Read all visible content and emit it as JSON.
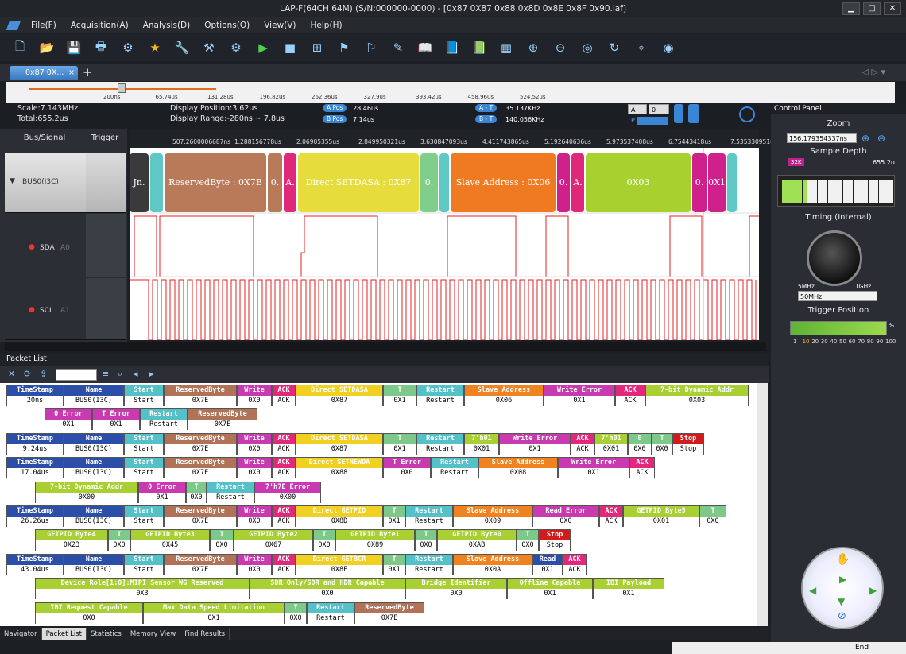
{
  "window": {
    "title": "LAP-F(64CH 64M) (S/N:000000-0000) - [0x87 0X87  0x88 0x8D 0x8E 0x8F 0x90.laf]"
  },
  "menu": [
    "File(F)",
    "Acquisition(A)",
    "Analysis(D)",
    "Options(O)",
    "View(V)",
    "Help(H)"
  ],
  "toolbar": [
    "new-file",
    "open-folder",
    "save",
    "print",
    "settings-save",
    "star",
    "wrench-gear",
    "tools",
    "gear",
    "run",
    "stop",
    "cursor-add",
    "cursor-flag",
    "cursor-marker",
    "brush",
    "book-open",
    "book-mark",
    "book-list",
    "binary",
    "zoom-in",
    "zoom-out",
    "zoom-fit",
    "refresh",
    "probe",
    "ring"
  ],
  "file_tab": {
    "label": "0x87 0X...",
    "close": "×",
    "add": "+"
  },
  "ruler": {
    "ticks": [
      "200ns",
      "65.74us",
      "131.28us",
      "196.82us",
      "262.36us",
      "327.9us",
      "393.42us",
      "458.96us",
      "524.52us"
    ]
  },
  "info": {
    "scale": "Scale:7.143MHz",
    "total": "Total:655.2us",
    "display_position": "Display Position:3.62us",
    "display_range": "Display Range:-280ns ~ 7.8us",
    "a_pos_label": "A Pos",
    "a_pos": "28.46us",
    "b_pos_label": "B Pos",
    "b_pos": "7.14us",
    "a_t_label": "A - T",
    "a_t": "35.137KHz",
    "b_t_label": "B - T",
    "b_t": "140.056KHz",
    "sel_a": "A",
    "sel_0": "0",
    "p_label": "P"
  },
  "signals": {
    "header_bus": "Bus/Signal",
    "header_trigger": "Trigger",
    "rows": [
      {
        "name": "BUS0(I3C)"
      },
      {
        "name": "SDA",
        "ch": "A0"
      },
      {
        "name": "SCL",
        "ch": "A1"
      }
    ]
  },
  "wave_ticks": [
    "507.2600006687ns",
    "1.288156778us",
    "2.06905355us",
    "2.849950321us",
    "3.630847093us",
    "4.411743865us",
    "5.192640636us",
    "5.973537408us",
    "6.75443418us",
    "7.535330951us"
  ],
  "segments": [
    {
      "label": "Jn.",
      "color": "#3a3a3a"
    },
    {
      "label": "",
      "color": "#5fc7c4"
    },
    {
      "label": "ReservedByte : 0X7E",
      "color": "#b97a5a"
    },
    {
      "label": "0.",
      "color": "#b97a5a"
    },
    {
      "label": "A.",
      "color": "#e0287a"
    },
    {
      "label": "Direct SETDASA : 0X87",
      "color": "#e6dc3b"
    },
    {
      "label": "0.",
      "color": "#7fcf8a"
    },
    {
      "label": "",
      "color": "#5fc7c4"
    },
    {
      "label": "Slave Address : 0X06",
      "color": "#f07a22"
    },
    {
      "label": "0.",
      "color": "#d0208c"
    },
    {
      "label": "A.",
      "color": "#e0287a"
    },
    {
      "label": "0X03",
      "color": "#a7d12e"
    },
    {
      "label": "0.",
      "color": "#d0208c"
    },
    {
      "label": "0X1",
      "color": "#d0208c"
    },
    {
      "label": "",
      "color": "#5fc7c4"
    }
  ],
  "control_panel": {
    "title": "Control Panel",
    "zoom_label": "Zoom",
    "zoom_value": "156.179354337ns",
    "depth_label": "Sample Depth",
    "depth_marker": "32K",
    "depth_value": "655.2u",
    "timing_label": "Timing (Internal)",
    "knob_min": "5MHz",
    "knob_max": "1GHz",
    "rate": "50MHz",
    "trigger_label": "Trigger Position",
    "trigger_pct": "%",
    "trigger_scale": [
      "1",
      "10",
      "20",
      "30",
      "40",
      "50",
      "60",
      "70",
      "80",
      "90",
      "100"
    ]
  },
  "packet_list": {
    "title": "Packet List",
    "rows": [
      [
        {
          "h": "TimeStamp",
          "v": "20ns",
          "c": "#2b4fa8",
          "w": 72
        },
        {
          "h": "Name",
          "v": "BUS0(I3C)",
          "c": "#2b4fa8",
          "w": 76
        },
        {
          "h": "Start",
          "v": "Start",
          "c": "#54c0c8",
          "w": 50
        },
        {
          "h": "ReservedByte",
          "v": "0X7E",
          "c": "#b07357",
          "w": 92
        },
        {
          "h": "Write",
          "v": "0X0",
          "c": "#c93ab0",
          "w": 44
        },
        {
          "h": "ACK",
          "v": "ACK",
          "c": "#e3287b",
          "w": 30
        },
        {
          "h": "Direct SETDASA",
          "v": "0X87",
          "c": "#f0d020",
          "w": 110
        },
        {
          "h": "T",
          "v": "0X1",
          "c": "#7cc98a",
          "w": 42
        },
        {
          "h": "Restart",
          "v": "Restart",
          "c": "#54c0c8",
          "w": 60
        },
        {
          "h": "Slave Address",
          "v": "0X06",
          "c": "#f0821f",
          "w": 100
        },
        {
          "h": "Write Error",
          "v": "0X1",
          "c": "#c93ab0",
          "w": 90
        },
        {
          "h": "ACK",
          "v": "ACK",
          "c": "#e3287b",
          "w": 38
        },
        {
          "h": "7-bit Dynamic Addr",
          "v": "0X03",
          "c": "#a8d032",
          "w": 130
        }
      ],
      [
        {
          "h": "0 Error",
          "v": "0X1",
          "c": "#c93ab0",
          "w": 60,
          "indent": 48
        },
        {
          "h": "T Error",
          "v": "0X1",
          "c": "#c93ab0",
          "w": 60
        },
        {
          "h": "Restart",
          "v": "Restart",
          "c": "#54c0c8",
          "w": 60
        },
        {
          "h": "ReservedByte",
          "v": "0X7E",
          "c": "#b07357",
          "w": 88
        }
      ],
      [
        {
          "h": "TimeStamp",
          "v": "9.24us",
          "c": "#2b4fa8",
          "w": 72
        },
        {
          "h": "Name",
          "v": "BUS0(I3C)",
          "c": "#2b4fa8",
          "w": 76
        },
        {
          "h": "Start",
          "v": "Start",
          "c": "#54c0c8",
          "w": 50
        },
        {
          "h": "ReservedByte",
          "v": "0X7E",
          "c": "#b07357",
          "w": 92
        },
        {
          "h": "Write",
          "v": "0X0",
          "c": "#c93ab0",
          "w": 44
        },
        {
          "h": "ACK",
          "v": "ACK",
          "c": "#e3287b",
          "w": 30
        },
        {
          "h": "Direct SETDASA",
          "v": "0X87",
          "c": "#f0d020",
          "w": 110
        },
        {
          "h": "T",
          "v": "0X1",
          "c": "#7cc98a",
          "w": 42
        },
        {
          "h": "Restart",
          "v": "Restart",
          "c": "#54c0c8",
          "w": 60
        },
        {
          "h": "7'h01",
          "v": "0X01",
          "c": "#a8d032",
          "w": 44
        },
        {
          "h": "Write Error",
          "v": "0X1",
          "c": "#c93ab0",
          "w": 90
        },
        {
          "h": "ACK",
          "v": "ACK",
          "c": "#e3287b",
          "w": 30
        },
        {
          "h": "7'h01",
          "v": "0X01",
          "c": "#a8d032",
          "w": 42
        },
        {
          "h": "0",
          "v": "0X0",
          "c": "#7cc98a",
          "w": 30
        },
        {
          "h": "T",
          "v": "0X0",
          "c": "#7cc98a",
          "w": 26
        },
        {
          "h": "Stop",
          "v": "Stop",
          "c": "#d01c1c",
          "w": 40
        }
      ],
      [
        {
          "h": "TimeStamp",
          "v": "17.04us",
          "c": "#2b4fa8",
          "w": 72
        },
        {
          "h": "Name",
          "v": "BUS0(I3C)",
          "c": "#2b4fa8",
          "w": 76
        },
        {
          "h": "Start",
          "v": "Start",
          "c": "#54c0c8",
          "w": 50
        },
        {
          "h": "ReservedByte",
          "v": "0X7E",
          "c": "#b07357",
          "w": 92
        },
        {
          "h": "Write",
          "v": "0X0",
          "c": "#c93ab0",
          "w": 44
        },
        {
          "h": "ACK",
          "v": "ACK",
          "c": "#e3287b",
          "w": 30
        },
        {
          "h": "Direct SETNEWDA",
          "v": "0X88",
          "c": "#f0d020",
          "w": 110
        },
        {
          "h": "T Error",
          "v": "0X0",
          "c": "#c93ab0",
          "w": 60
        },
        {
          "h": "Restart",
          "v": "Restart",
          "c": "#54c0c8",
          "w": 60
        },
        {
          "h": "Slave Address",
          "v": "0X08",
          "c": "#f0821f",
          "w": 100
        },
        {
          "h": "Write Error",
          "v": "0X1",
          "c": "#c93ab0",
          "w": 90
        },
        {
          "h": "ACK",
          "v": "ACK",
          "c": "#e3287b",
          "w": 32
        }
      ],
      [
        {
          "h": "7-bit Dynamic Addr",
          "v": "0X00",
          "c": "#a8d032",
          "w": 130,
          "indent": 36
        },
        {
          "h": "0 Error",
          "v": "0X1",
          "c": "#c93ab0",
          "w": 60
        },
        {
          "h": "T",
          "v": "0X0",
          "c": "#7cc98a",
          "w": 26
        },
        {
          "h": "Restart",
          "v": "Restart",
          "c": "#54c0c8",
          "w": 60
        },
        {
          "h": "7'h7E Error",
          "v": "0X00",
          "c": "#c93ab0",
          "w": 84
        }
      ],
      [
        {
          "h": "TimeStamp",
          "v": "26.26us",
          "c": "#2b4fa8",
          "w": 72
        },
        {
          "h": "Name",
          "v": "BUS0(I3C)",
          "c": "#2b4fa8",
          "w": 76
        },
        {
          "h": "Start",
          "v": "Start",
          "c": "#54c0c8",
          "w": 50
        },
        {
          "h": "ReservedByte",
          "v": "0X7E",
          "c": "#b07357",
          "w": 92
        },
        {
          "h": "Write",
          "v": "0X0",
          "c": "#c93ab0",
          "w": 44
        },
        {
          "h": "ACK",
          "v": "ACK",
          "c": "#e3287b",
          "w": 30
        },
        {
          "h": "Direct GETPID",
          "v": "0X8D",
          "c": "#f0d020",
          "w": 110
        },
        {
          "h": "T",
          "v": "0X1",
          "c": "#7cc98a",
          "w": 28
        },
        {
          "h": "Restart",
          "v": "Restart",
          "c": "#54c0c8",
          "w": 60
        },
        {
          "h": "Slave Address",
          "v": "0X09",
          "c": "#f0821f",
          "w": 100
        },
        {
          "h": "Read Error",
          "v": "0X0",
          "c": "#c93ab0",
          "w": 84
        },
        {
          "h": "ACK",
          "v": "ACK",
          "c": "#e3287b",
          "w": 30
        },
        {
          "h": "GETPID Byte5",
          "v": "0X01",
          "c": "#a8d032",
          "w": 96
        },
        {
          "h": "T",
          "v": "0X0",
          "c": "#7cc98a",
          "w": 34
        }
      ],
      [
        {
          "h": "GETPID Byte4",
          "v": "0X23",
          "c": "#a8d032",
          "w": 92,
          "indent": 36
        },
        {
          "h": "T",
          "v": "0X0",
          "c": "#7cc98a",
          "w": 28
        },
        {
          "h": "GETPID Byte3",
          "v": "0X45",
          "c": "#a8d032",
          "w": 100
        },
        {
          "h": "T",
          "v": "0X0",
          "c": "#7cc98a",
          "w": 30
        },
        {
          "h": "GETPID Byte2",
          "v": "0X67",
          "c": "#a8d032",
          "w": 100
        },
        {
          "h": "T",
          "v": "0X0",
          "c": "#7cc98a",
          "w": 28
        },
        {
          "h": "GETPID Byte1",
          "v": "0X89",
          "c": "#a8d032",
          "w": 100
        },
        {
          "h": "T",
          "v": "0X0",
          "c": "#7cc98a",
          "w": 28
        },
        {
          "h": "GETPID Byte0",
          "v": "0XAB",
          "c": "#a8d032",
          "w": 100
        },
        {
          "h": "T",
          "v": "0X0",
          "c": "#7cc98a",
          "w": 28
        },
        {
          "h": "Stop",
          "v": "Stop",
          "c": "#d01c1c",
          "w": 40
        }
      ],
      [
        {
          "h": "TimeStamp",
          "v": "43.04us",
          "c": "#2b4fa8",
          "w": 72
        },
        {
          "h": "Name",
          "v": "BUS0(I3C)",
          "c": "#2b4fa8",
          "w": 76
        },
        {
          "h": "Start",
          "v": "Start",
          "c": "#54c0c8",
          "w": 50
        },
        {
          "h": "ReservedByte",
          "v": "0X7E",
          "c": "#b07357",
          "w": 92
        },
        {
          "h": "Write",
          "v": "0X0",
          "c": "#c93ab0",
          "w": 44
        },
        {
          "h": "ACK",
          "v": "ACK",
          "c": "#e3287b",
          "w": 30
        },
        {
          "h": "Direct GETBCR",
          "v": "0X8E",
          "c": "#f0d020",
          "w": 110
        },
        {
          "h": "T",
          "v": "0X1",
          "c": "#7cc98a",
          "w": 28
        },
        {
          "h": "Restart",
          "v": "Restart",
          "c": "#54c0c8",
          "w": 60
        },
        {
          "h": "Slave Address",
          "v": "0X0A",
          "c": "#f0821f",
          "w": 100
        },
        {
          "h": "Read",
          "v": "0X1",
          "c": "#2b4fa8",
          "w": 38
        },
        {
          "h": "ACK",
          "v": "ACK",
          "c": "#e3287b",
          "w": 30
        }
      ],
      [
        {
          "h": "Device Role[1:0]:MIPI Sensor WG Reserved",
          "v": "0X3",
          "c": "#a8d032",
          "w": 270,
          "indent": 36
        },
        {
          "h": "SDR Only/SDR and HDR Capable",
          "v": "0X0",
          "c": "#a8d032",
          "w": 196
        },
        {
          "h": "Bridge Identifier",
          "v": "0X0",
          "c": "#a8d032",
          "w": 128
        },
        {
          "h": "Offline Capable",
          "v": "0X1",
          "c": "#a8d032",
          "w": 108
        },
        {
          "h": "IBI Payload",
          "v": "0X1",
          "c": "#a8d032",
          "w": 90
        }
      ],
      [
        {
          "h": "IBI Request Capable",
          "v": "0X0",
          "c": "#a8d032",
          "w": 136,
          "indent": 36
        },
        {
          "h": "Max Data Speed Limitation",
          "v": "0X1",
          "c": "#a8d032",
          "w": 178
        },
        {
          "h": "T",
          "v": "0X0",
          "c": "#7cc98a",
          "w": 28
        },
        {
          "h": "Restart",
          "v": "Restart",
          "c": "#54c0c8",
          "w": 60
        },
        {
          "h": "ReservedByte",
          "v": "0X7E",
          "c": "#b07357",
          "w": 88
        }
      ]
    ]
  },
  "bottom_tabs": [
    "Navigator",
    "Packet List",
    "Statistics",
    "Memory View",
    "Find Results"
  ],
  "status": {
    "end": "End"
  }
}
